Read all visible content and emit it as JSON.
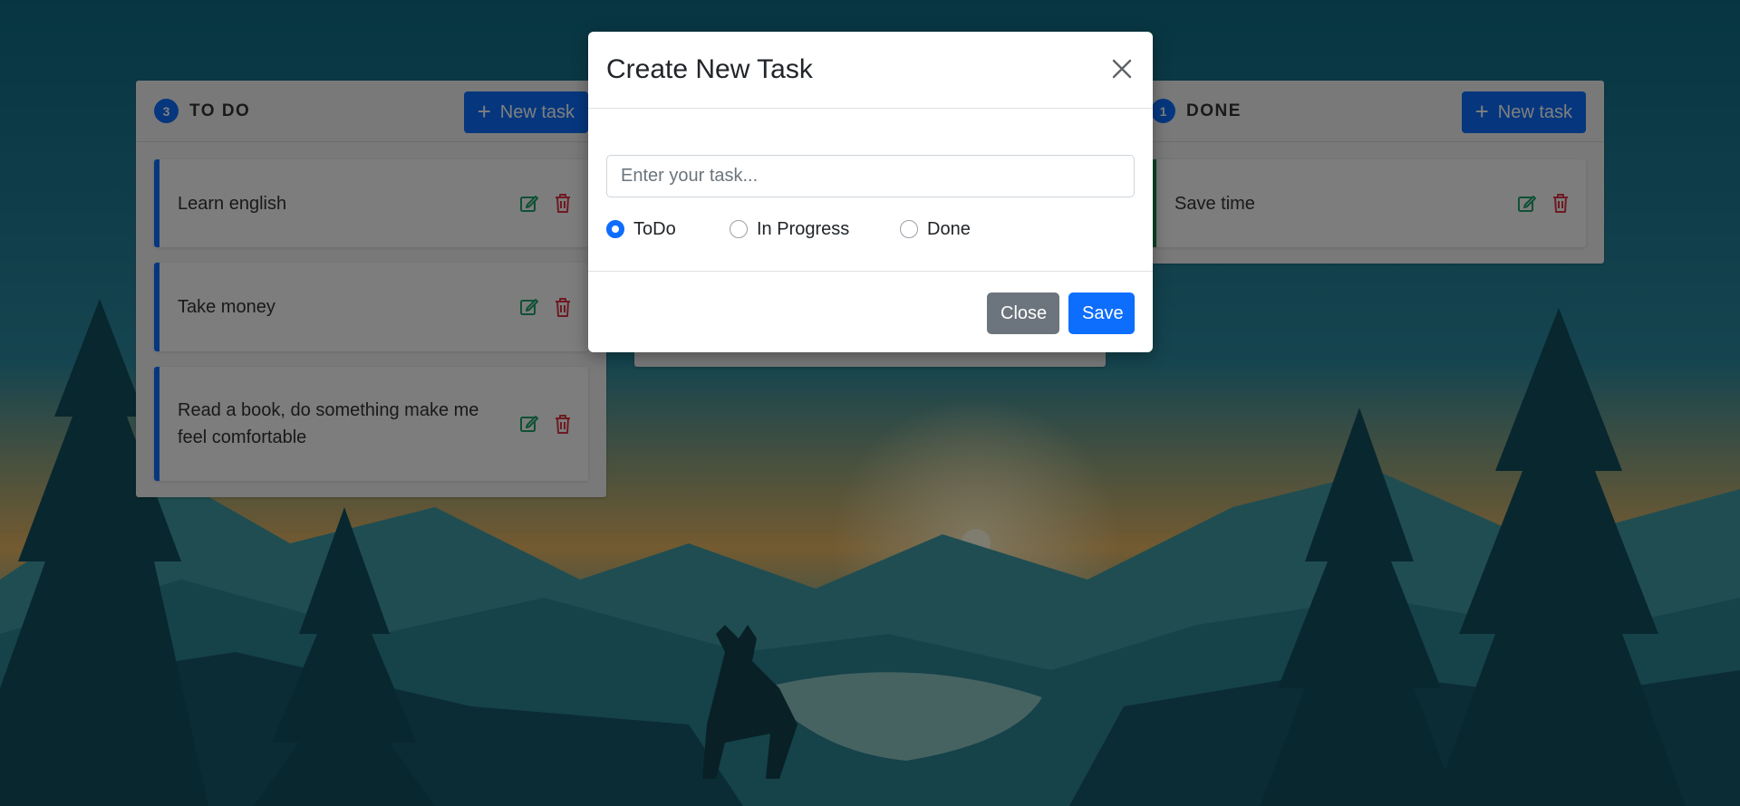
{
  "columns": [
    {
      "count": "3",
      "title": "TO DO",
      "new_task_label": "New task",
      "accent": "#0d6efd",
      "cards": [
        {
          "text": "Learn english"
        },
        {
          "text": "Take money"
        },
        {
          "text": "Read a book, do something make me feel comfortable"
        }
      ]
    },
    {
      "count": "1",
      "title": "DONE",
      "new_task_label": "New task",
      "accent": "#198754",
      "cards": [
        {
          "text": "Save time"
        }
      ]
    }
  ],
  "modal": {
    "title": "Create New Task",
    "input_placeholder": "Enter your task...",
    "input_value": "",
    "status_options": [
      {
        "label": "ToDo",
        "checked": true
      },
      {
        "label": "In Progress",
        "checked": false
      },
      {
        "label": "Done",
        "checked": false
      }
    ],
    "close_label": "Close",
    "save_label": "Save"
  },
  "icons": {
    "add": "plus-icon",
    "edit": "edit-icon",
    "delete": "trash-icon",
    "close": "close-icon"
  },
  "colors": {
    "primary": "#0d6efd",
    "edit": "#20a36b",
    "delete": "#dc3545",
    "secondary": "#6c757d"
  }
}
